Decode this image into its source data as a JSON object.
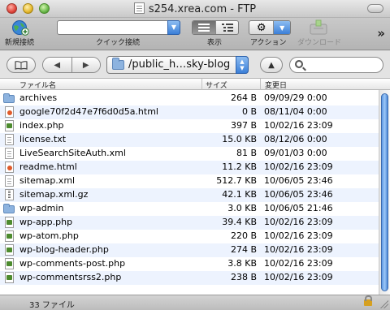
{
  "window": {
    "title": "s254.xrea.com - FTP"
  },
  "toolbar": {
    "new_connection_label": "新規接続",
    "quick_connect_label": "クイック接続",
    "quick_connect_value": "",
    "view_label": "表示",
    "action_label": "アクション",
    "disconnect_label": "ダウンロード",
    "overflow": "»"
  },
  "navbar": {
    "path": "/public_h…sky-blog",
    "search_value": ""
  },
  "columns": {
    "name": "ファイル名",
    "size": "サイズ",
    "modified": "変更日"
  },
  "files": [
    {
      "name": "archives",
      "size": "264 B",
      "modified": "09/09/29 0:00",
      "type": "folder"
    },
    {
      "name": "google70f2d47e7f6d0d5a.html",
      "size": "0 B",
      "modified": "08/11/04 0:00",
      "type": "html"
    },
    {
      "name": "index.php",
      "size": "397 B",
      "modified": "10/02/16 23:09",
      "type": "code"
    },
    {
      "name": "license.txt",
      "size": "15.0 KB",
      "modified": "08/12/06 0:00",
      "type": "doc"
    },
    {
      "name": "LiveSearchSiteAuth.xml",
      "size": "81 B",
      "modified": "09/01/03 0:00",
      "type": "doc"
    },
    {
      "name": "readme.html",
      "size": "11.2 KB",
      "modified": "10/02/16 23:09",
      "type": "html"
    },
    {
      "name": "sitemap.xml",
      "size": "512.7 KB",
      "modified": "10/06/05 23:46",
      "type": "doc"
    },
    {
      "name": "sitemap.xml.gz",
      "size": "42.1 KB",
      "modified": "10/06/05 23:46",
      "type": "zip"
    },
    {
      "name": "wp-admin",
      "size": "3.0 KB",
      "modified": "10/06/05 21:46",
      "type": "folder"
    },
    {
      "name": "wp-app.php",
      "size": "39.4 KB",
      "modified": "10/02/16 23:09",
      "type": "code"
    },
    {
      "name": "wp-atom.php",
      "size": "220 B",
      "modified": "10/02/16 23:09",
      "type": "code"
    },
    {
      "name": "wp-blog-header.php",
      "size": "274 B",
      "modified": "10/02/16 23:09",
      "type": "code"
    },
    {
      "name": "wp-comments-post.php",
      "size": "3.8 KB",
      "modified": "10/02/16 23:09",
      "type": "code"
    },
    {
      "name": "wp-commentsrss2.php",
      "size": "238 B",
      "modified": "10/02/16 23:09",
      "type": "code"
    }
  ],
  "status": {
    "text": "33 ファイル"
  }
}
